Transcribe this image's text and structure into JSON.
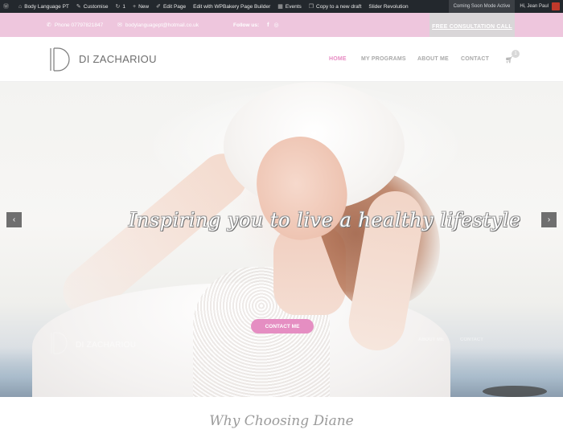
{
  "admin_bar": {
    "items": [
      {
        "icon": "wordpress-icon",
        "label": ""
      },
      {
        "icon": "home-icon",
        "label": "Body Language PT"
      },
      {
        "icon": "brush-icon",
        "label": "Customise"
      },
      {
        "icon": "refresh-icon",
        "label": "1"
      },
      {
        "icon": "plus-icon",
        "label": "New"
      },
      {
        "icon": "pencil-icon",
        "label": "Edit Page"
      },
      {
        "icon": "",
        "label": "Edit with WPBakery Page Builder"
      },
      {
        "icon": "calendar-icon",
        "label": "Events"
      },
      {
        "icon": "copy-icon",
        "label": "Copy to a new draft"
      },
      {
        "icon": "",
        "label": "Slider Revolution"
      }
    ],
    "coming_soon": "Coming Soon Mode Active",
    "greeting": "Hi, Jean Paul"
  },
  "top_bar": {
    "phone": "Phone 07797821847",
    "email": "bodylanguagept@hotmail.co.uk",
    "follow_label": "Follow us:",
    "cta": "FREE CONSULTATION CALL"
  },
  "header": {
    "logo_text": "DI ZACHARIOU",
    "nav": [
      "HOME",
      "MY PROGRAMS",
      "ABOUT ME",
      "CONTACT"
    ],
    "active_nav": "HOME",
    "cart_count": "1"
  },
  "hero": {
    "tagline": "Inspiring you to live a healthy lifestyle",
    "button": "CONTACT ME",
    "ghost_logo_text": "DI ZACHARIOU",
    "ghost_nav": [
      "ABOUT ME",
      "CONTACT"
    ],
    "prev_arrow": "‹",
    "next_arrow": "›"
  },
  "section": {
    "title": "Why Choosing Diane"
  },
  "colors": {
    "pink": "#eec6dd",
    "accent": "#e78cc3",
    "admin_bg": "#23282d"
  }
}
